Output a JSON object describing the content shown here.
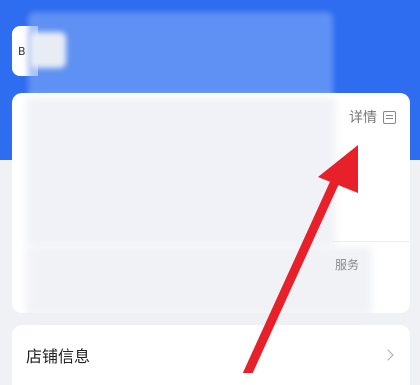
{
  "header": {
    "corner_tab_text": "B"
  },
  "card": {
    "detail_link": {
      "label": "详情",
      "icon": "document-list-icon"
    },
    "service_label": "服务"
  },
  "shop_info": {
    "label": "店铺信息",
    "icon": "chevron-right-icon"
  },
  "annotation": {
    "arrow_color": "#e8202a"
  },
  "colors": {
    "header_blue": "#2e6cf0",
    "page_bg": "#f0f1f5",
    "card_bg": "#ffffff"
  }
}
